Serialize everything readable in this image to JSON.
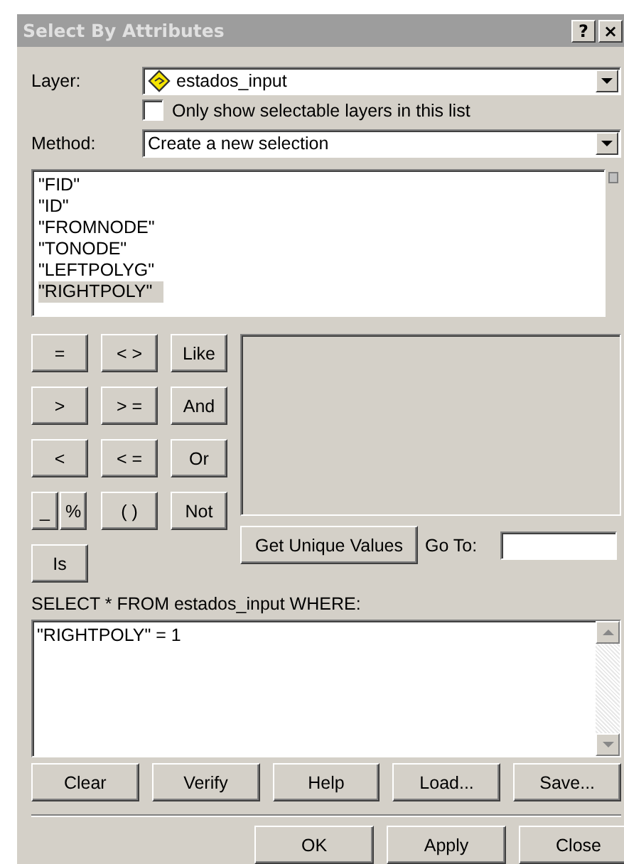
{
  "window": {
    "title": "Select By Attributes",
    "title_buttons": [
      "?",
      "×"
    ]
  },
  "layer": {
    "label": "Layer:",
    "value": "estados_input"
  },
  "selectable_only": {
    "label": "Only show selectable layers in this list",
    "checked": false
  },
  "method": {
    "label": "Method:",
    "value": "Create a new selection"
  },
  "fields": [
    {
      "name": "\"FID\"",
      "selected": false
    },
    {
      "name": "\"ID\"",
      "selected": false
    },
    {
      "name": "\"FROMNODE\"",
      "selected": false
    },
    {
      "name": "\"TONODE\"",
      "selected": false
    },
    {
      "name": "\"LEFTPOLYG\"",
      "selected": false
    },
    {
      "name": "\"RIGHTPOLY\"",
      "selected": true
    }
  ],
  "operators": [
    {
      "kind": "single",
      "labels": [
        "="
      ]
    },
    {
      "kind": "single",
      "labels": [
        "< >"
      ]
    },
    {
      "kind": "single",
      "labels": [
        "Like"
      ]
    },
    {
      "kind": "single",
      "labels": [
        ">"
      ]
    },
    {
      "kind": "single",
      "labels": [
        "> ="
      ]
    },
    {
      "kind": "single",
      "labels": [
        "And"
      ]
    },
    {
      "kind": "single",
      "labels": [
        "<"
      ]
    },
    {
      "kind": "single",
      "labels": [
        "< ="
      ]
    },
    {
      "kind": "single",
      "labels": [
        "Or"
      ]
    },
    {
      "kind": "split",
      "labels": [
        "_",
        "%"
      ]
    },
    {
      "kind": "single",
      "labels": [
        "( )"
      ]
    },
    {
      "kind": "single",
      "labels": [
        "Not"
      ]
    },
    {
      "kind": "single",
      "labels": [
        "Is"
      ]
    }
  ],
  "get_unique_values": "Get Unique Values",
  "go_to": {
    "label": "Go To:"
  },
  "query": {
    "label": "SELECT * FROM estados_input WHERE:",
    "value": "\"RIGHTPOLY\" = 1"
  },
  "query_buttons": [
    "Clear",
    "Verify",
    "Help",
    "Load...",
    "Save..."
  ],
  "dialog_buttons": [
    "OK",
    "Apply",
    "Close"
  ]
}
